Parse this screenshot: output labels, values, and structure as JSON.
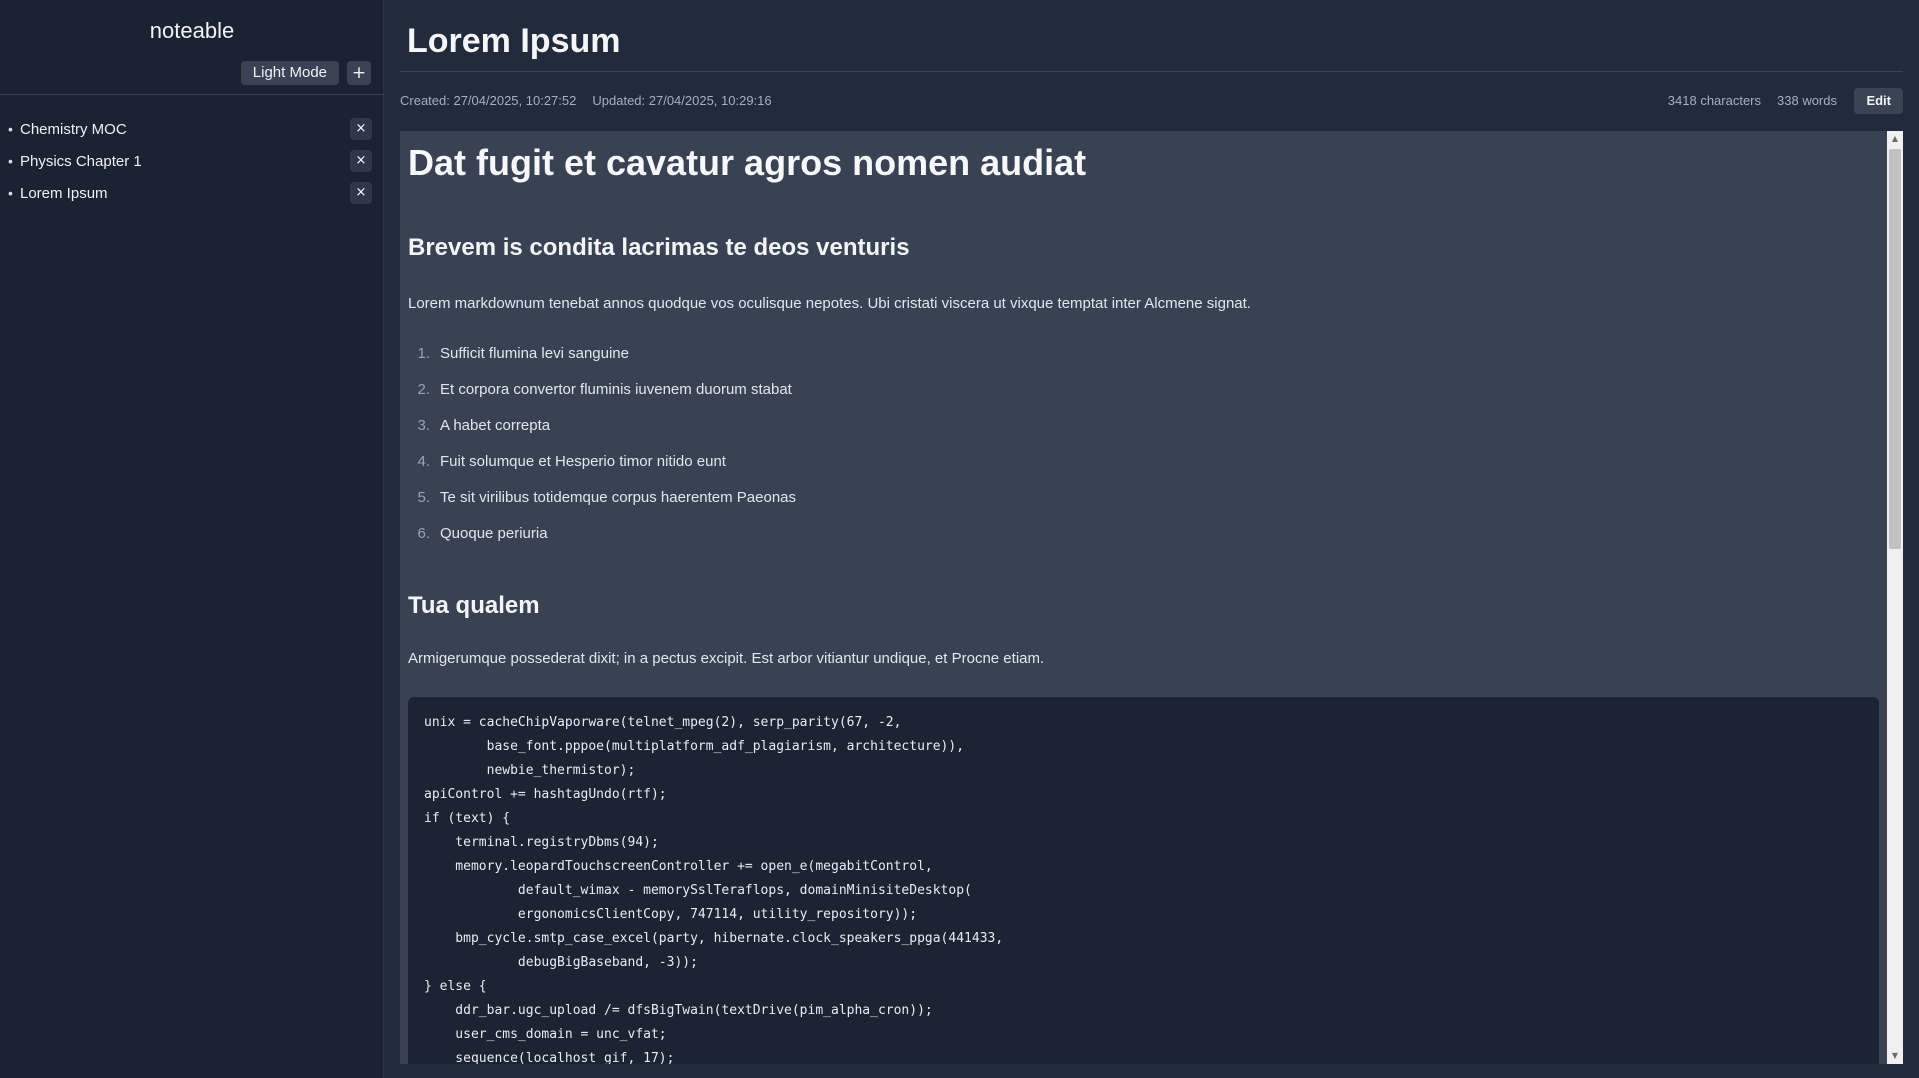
{
  "sidebar": {
    "app_name": "noteable",
    "mode_button": "Light Mode",
    "add_button": "+",
    "notes": [
      {
        "label": "Chemistry MOC"
      },
      {
        "label": "Physics Chapter 1"
      },
      {
        "label": "Lorem Ipsum"
      }
    ],
    "bullet": "•",
    "close_glyph": "×"
  },
  "main": {
    "title": "Lorem Ipsum",
    "created": "Created: 27/04/2025, 10:27:52",
    "updated": "Updated: 27/04/2025, 10:29:16",
    "characters": "3418 characters",
    "words": "338 words",
    "edit_button": "Edit"
  },
  "content": {
    "h1": "Dat fugit et cavatur agros nomen audiat",
    "h2_1": "Brevem is condita lacrimas te deos venturis",
    "para_1": "Lorem markdownum tenebat annos quodque vos oculisque nepotes. Ubi cristati viscera ut vixque temptat inter Alcmene signat.",
    "list": [
      {
        "num": "1.",
        "text": "Sufficit flumina levi sanguine"
      },
      {
        "num": "2.",
        "text": "Et corpora convertor fluminis iuvenem duorum stabat"
      },
      {
        "num": "3.",
        "text": "A habet correpta"
      },
      {
        "num": "4.",
        "text": "Fuit solumque et Hesperio timor nitido eunt"
      },
      {
        "num": "5.",
        "text": "Te sit virilibus totidemque corpus haerentem Paeonas"
      },
      {
        "num": "6.",
        "text": "Quoque periuria"
      }
    ],
    "h2_2": "Tua qualem",
    "para_2": "Armigerumque possederat dixit; in a pectus excipit. Est arbor vitiantur undique, et Procne etiam.",
    "code": "unix = cacheChipVaporware(telnet_mpeg(2), serp_parity(67, -2,\n        base_font.pppoe(multiplatform_adf_plagiarism, architecture)),\n        newbie_thermistor);\napiControl += hashtagUndo(rtf);\nif (text) {\n    terminal.registryDbms(94);\n    memory.leopardTouchscreenController += open_e(megabitControl,\n            default_wimax - memorySslTeraflops, domainMinisiteDesktop(\n            ergonomicsClientCopy, 747114, utility_repository));\n    bmp_cycle.smtp_case_excel(party, hibernate.clock_speakers_ppga(441433,\n            debugBigBaseband, -3));\n} else {\n    ddr_bar.ugc_upload /= dfsBigTwain(textDrive(pim_alpha_cron));\n    user_cms_domain = unc_vfat;\n    sequence(localhost_gif, 17);"
  },
  "scrollbar": {
    "up_glyph": "▲",
    "down_glyph": "▼"
  }
}
